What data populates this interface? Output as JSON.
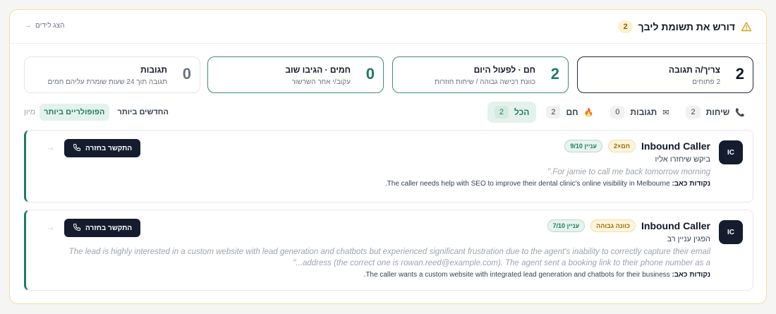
{
  "header": {
    "title": "דורש את תשומת ליבך",
    "count": "2",
    "warn_icon": "warning-triangle-icon",
    "view_leads_label": "הצג לידים",
    "view_leads_icon": "arrow-icon"
  },
  "cards": [
    {
      "number": "2",
      "title": "צריך/ה תגובה",
      "subtitle": "2 פתוחים"
    },
    {
      "number": "2",
      "title": "חם · לפעול היום",
      "subtitle": "כוונת רכישה גבוהה / שיחות חוזרות"
    },
    {
      "number": "0",
      "title": "חמים · הגיבו שוב",
      "subtitle": "עקוב/י אחר השרשור"
    },
    {
      "number": "0",
      "title": "תגובות",
      "subtitle": "תגובה תוך 24 שעות שומרת עליהם חמים"
    }
  ],
  "filters": [
    {
      "label": "הכל",
      "count": "2",
      "icon": "",
      "active": true
    },
    {
      "label": "חם",
      "count": "2",
      "icon": "🔥",
      "active": false
    },
    {
      "label": "תגובות",
      "count": "0",
      "icon": "✉",
      "active": false
    },
    {
      "label": "שיחות",
      "count": "2",
      "icon": "📞",
      "active": false
    }
  ],
  "sort": {
    "label": "מיון",
    "options": [
      "הפופולריים ביותר",
      "החדשים ביותר"
    ],
    "active_index": 0
  },
  "leads": [
    {
      "initials": "IC",
      "name": "Inbound Caller",
      "badge_amber": "חם×2",
      "badge_green": "עניין 9/10",
      "subtitle": "ביקש שיחזרו אליו",
      "quote": "For jamie to call me back tomorrow morning.\"",
      "points_label": "נקודות כאב:",
      "points_text": "The caller needs help with SEO to improve their dental clinic's online visibility in Melbourne.",
      "call_label": "התקשר בחזרה"
    },
    {
      "initials": "IC",
      "name": "Inbound Caller",
      "badge_amber": "כוונה גבוהה",
      "badge_green": "עניין 7/10",
      "subtitle": "הפגין עניין רב",
      "quote": "The lead is highly interested in a custom website with lead generation and chatbots but experienced significant frustration due to the agent's inability to correctly capture their email address (the correct one is rowan.reed@example.com). The agent sent a booking link to their phone number as a...\"",
      "points_label": "נקודות כאב:",
      "points_text": "The caller wants a custom website with integrated lead generation and chatbots for their business.",
      "call_label": "התקשר בחזרה"
    }
  ],
  "colors": {
    "accent_green": "#1f7a63",
    "dark": "#141c2e",
    "warn_border": "#f3dc9c"
  }
}
